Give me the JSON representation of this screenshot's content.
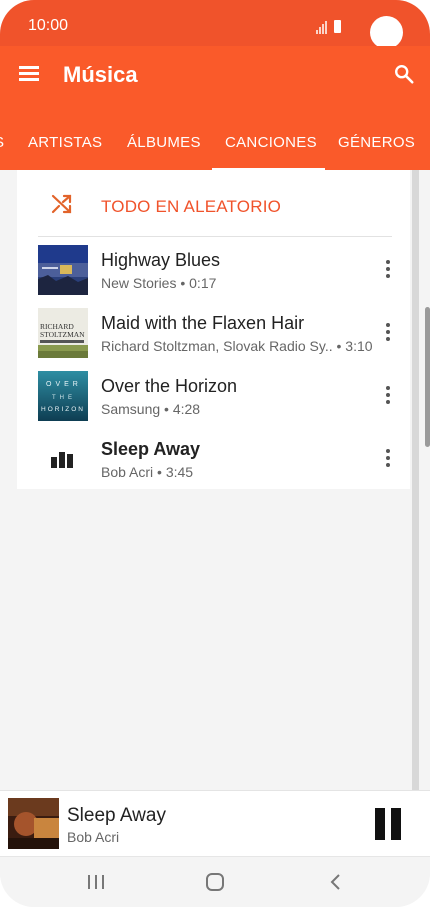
{
  "status_bar": {
    "time": "10:00"
  },
  "app_bar": {
    "title": "Música"
  },
  "tabs": [
    {
      "label": "S",
      "selected": false
    },
    {
      "label": "ARTISTAS",
      "selected": false
    },
    {
      "label": "ÁLBUMES",
      "selected": false
    },
    {
      "label": "CANCIONES",
      "selected": true
    },
    {
      "label": "GÉNEROS",
      "selected": false
    }
  ],
  "shuffle": {
    "label": "TODO EN ALEATORIO"
  },
  "songs": [
    {
      "title": "Highway Blues",
      "subtitle": "New Stories • 0:17",
      "playing": false
    },
    {
      "title": "Maid with the Flaxen Hair",
      "subtitle": "Richard Stoltzman, Slovak Radio Sy.. • 3:10",
      "playing": false,
      "album_art_text": [
        "RICHARD",
        "STOLTZMAN"
      ]
    },
    {
      "title": "Over the Horizon",
      "subtitle": "Samsung • 4:28",
      "playing": false,
      "album_art_text": [
        "OVER",
        "THE",
        "HORIZON"
      ]
    },
    {
      "title": "Sleep Away",
      "subtitle": "Bob Acri • 3:45",
      "playing": true
    }
  ],
  "mini_player": {
    "title": "Sleep Away",
    "artist": "Bob Acri",
    "state": "playing"
  },
  "colors": {
    "accent": "#fa5a2a",
    "status_bar": "#f0532b",
    "shuffle_text": "#f0532b"
  },
  "icons": {
    "menu": "menu-icon",
    "search": "search-icon",
    "shuffle": "shuffle-icon",
    "more": "more-vert-icon",
    "now_playing": "equalizer-icon",
    "pause": "pause-icon",
    "nav_recents": "recents-icon",
    "nav_home": "home-icon",
    "nav_back": "back-icon"
  }
}
